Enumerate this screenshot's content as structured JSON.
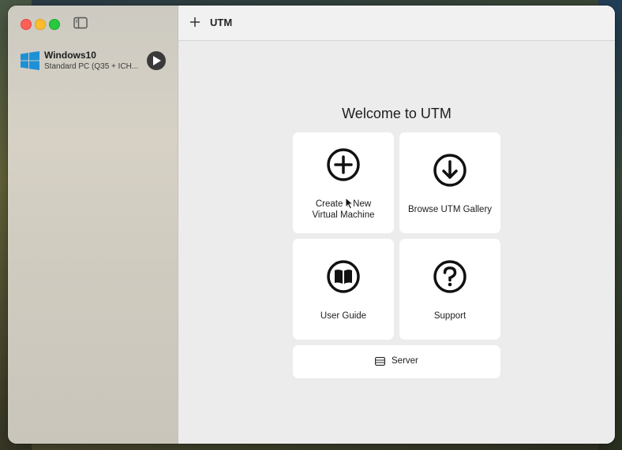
{
  "app": {
    "title": "UTM"
  },
  "sidebar": {
    "vms": [
      {
        "name": "Windows10",
        "description": "Standard PC (Q35 + ICH..."
      }
    ]
  },
  "main": {
    "welcome": "Welcome to UTM",
    "cards": [
      {
        "line1": "Create a New",
        "line2": "Virtual Machine",
        "icon": "plus-circle-icon"
      },
      {
        "label": "Browse UTM Gallery",
        "icon": "arrow-down-circle-icon"
      },
      {
        "label": "User Guide",
        "icon": "book-circle-icon"
      },
      {
        "label": "Support",
        "icon": "question-circle-icon"
      }
    ],
    "server_label": "Server"
  },
  "colors": {
    "close": "#fe5f57",
    "minimize": "#febc2e",
    "maximize": "#28c840",
    "windows_blue": "#1e90d6"
  }
}
